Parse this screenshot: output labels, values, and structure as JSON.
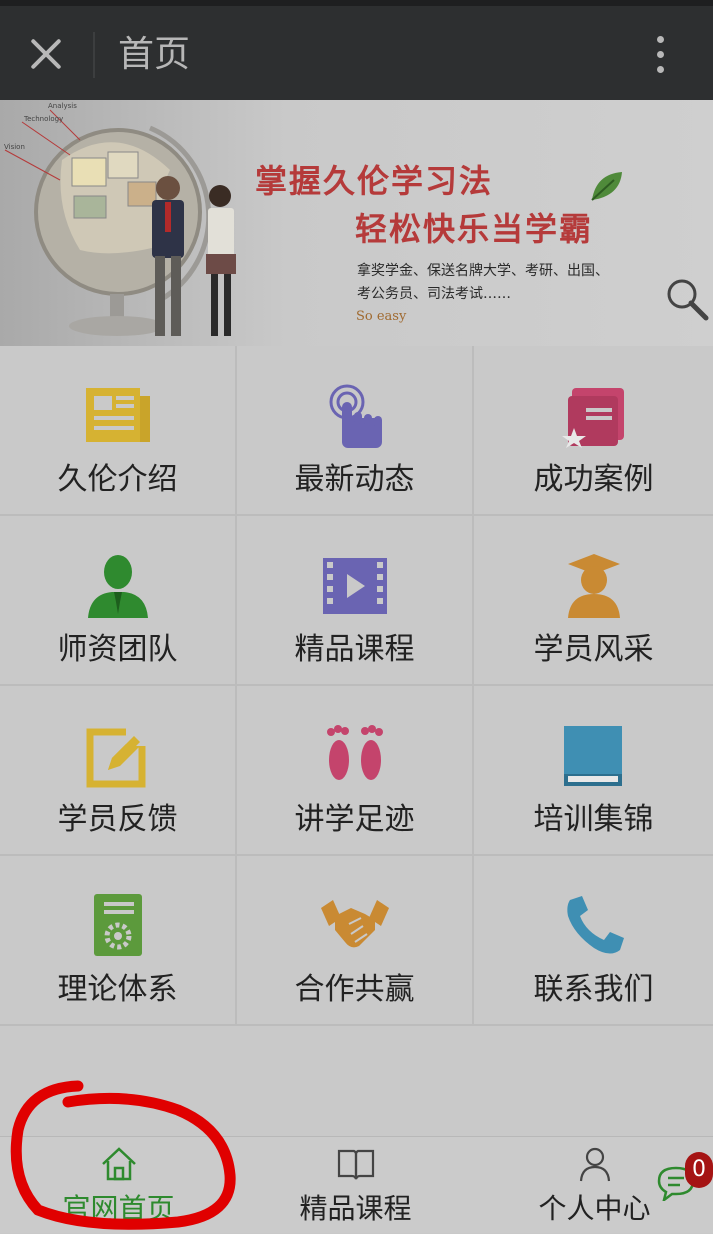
{
  "header": {
    "title": "首页"
  },
  "banner": {
    "line1": "掌握久伦学习法",
    "line2": "轻松快乐当学霸",
    "desc_line1": "拿奖学金、保送名牌大学、考研、出国、",
    "desc_line2": "考公务员、司法考试……",
    "tag": "So  easy",
    "globe_labels": [
      "Analysis",
      "Technology",
      "Vision"
    ]
  },
  "grid": [
    {
      "label": "久伦介绍",
      "icon": "newspaper-icon",
      "color": "#d6b232"
    },
    {
      "label": "最新动态",
      "icon": "tap-hand-icon",
      "color": "#6a64b2"
    },
    {
      "label": "成功案例",
      "icon": "book-star-icon",
      "color": "#c4446c"
    },
    {
      "label": "师资团队",
      "icon": "teacher-icon",
      "color": "#2f8a2f"
    },
    {
      "label": "精品课程",
      "icon": "video-icon",
      "color": "#6a64b2"
    },
    {
      "label": "学员风采",
      "icon": "graduate-icon",
      "color": "#c98a33"
    },
    {
      "label": "学员反馈",
      "icon": "edit-icon",
      "color": "#d6b232"
    },
    {
      "label": "讲学足迹",
      "icon": "footprints-icon",
      "color": "#c4446c"
    },
    {
      "label": "培训集锦",
      "icon": "book-icon",
      "color": "#3f8fb3"
    },
    {
      "label": "理论体系",
      "icon": "settings-book-icon",
      "color": "#5c9a3c"
    },
    {
      "label": "合作共赢",
      "icon": "handshake-icon",
      "color": "#c98a33"
    },
    {
      "label": "联系我们",
      "icon": "phone-icon",
      "color": "#3f8fb3"
    }
  ],
  "bottom_nav": {
    "home": "官网首页",
    "courses": "精品课程",
    "profile": "个人中心"
  },
  "chat": {
    "badge_count": "0"
  },
  "colors": {
    "active_nav": "#2e8a2e",
    "annotation": "#e00000"
  }
}
